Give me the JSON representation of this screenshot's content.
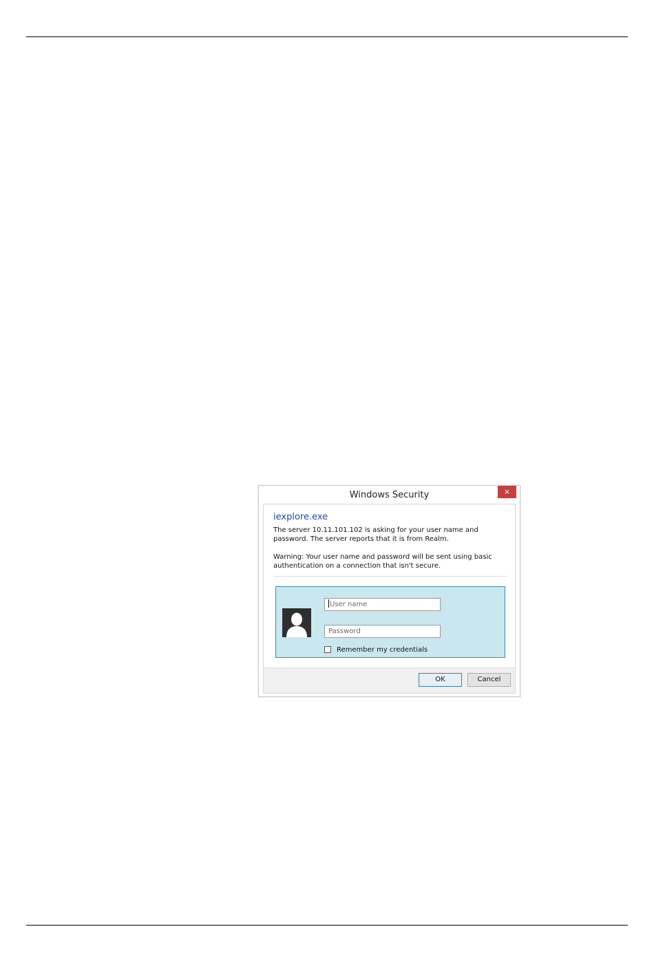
{
  "dialog": {
    "title": "Windows Security",
    "close_glyph": "×",
    "app_name": "iexplore.exe",
    "message": "The server 10.11.101.102 is asking for your user name and password. The server reports that it is from Realm.",
    "warning": "Warning: Your user name and password will be sent using basic authentication on a connection that isn't secure.",
    "username_placeholder": "User name",
    "password_placeholder": "Password",
    "remember_label": "Remember my credentials",
    "ok_label": "OK",
    "cancel_label": "Cancel",
    "icons": {
      "close": "close-icon",
      "user_tile": "user-avatar-icon"
    },
    "colors": {
      "accent": "#1e4e9c",
      "close_button": "#c7403f",
      "credential_tile": "#c9e7ef",
      "credential_border": "#3a87b8"
    }
  }
}
